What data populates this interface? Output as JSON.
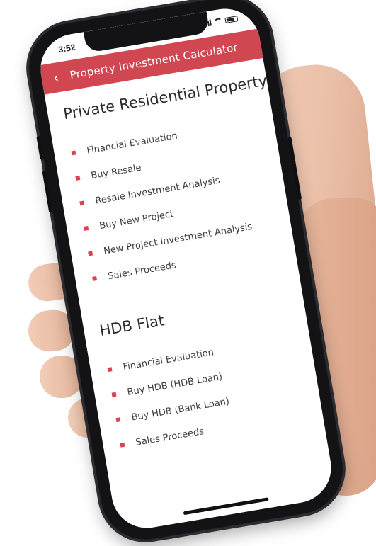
{
  "colors": {
    "accent": "#d14751",
    "bullet": "#d94351",
    "text": "#3d3d3d",
    "heading": "#2b2b2b"
  },
  "status_bar": {
    "time": "3:52"
  },
  "app_bar": {
    "back_icon": "chevron-left-icon",
    "title": "Property Investment Calculator"
  },
  "sections": [
    {
      "title": "Private Residential Property",
      "items": [
        "Financial Evaluation",
        "Buy Resale",
        "Resale Investment Analysis",
        "Buy New Project",
        "New Project Investment Analysis",
        "Sales Proceeds"
      ]
    },
    {
      "title": "HDB Flat",
      "items": [
        "Financial Evaluation",
        "Buy HDB (HDB Loan)",
        "Buy HDB (Bank Loan)",
        "Sales Proceeds"
      ]
    }
  ]
}
